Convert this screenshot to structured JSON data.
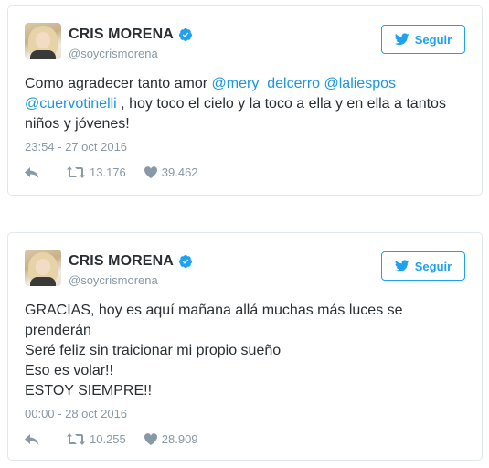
{
  "tweets": [
    {
      "name": "CRIS MORENA",
      "handle": "@soycrismorena",
      "follow_label": "Seguir",
      "text_parts": {
        "t1": "Como agradecer tanto amor ",
        "m1": "@mery_delcerro",
        "t2": " ",
        "m2": "@laliespos",
        "m3": "@cuervotinelli",
        "t3": " , hoy toco el cielo y la toco a ella y en ella a tantos",
        "t4": "niños y jóvenes!"
      },
      "timestamp": "23:54 - 27 oct 2016",
      "retweets": "13.176",
      "likes": "39.462"
    },
    {
      "name": "CRIS MORENA",
      "handle": "@soycrismorena",
      "follow_label": "Seguir",
      "lines": [
        "GRACIAS, hoy es aquí mañana allá muchas más luces se",
        "prenderán",
        "Seré feliz sin traicionar mi propio sueño",
        "Eso es volar!!",
        "ESTOY SIEMPRE!!"
      ],
      "timestamp": "00:00 - 28 oct 2016",
      "retweets": "10.255",
      "likes": "28.909"
    }
  ],
  "colors": {
    "accent": "#1da1f2",
    "mention": "#1b95e0",
    "muted": "#8899a6",
    "text": "#292f33",
    "border": "#e1e8ed"
  }
}
